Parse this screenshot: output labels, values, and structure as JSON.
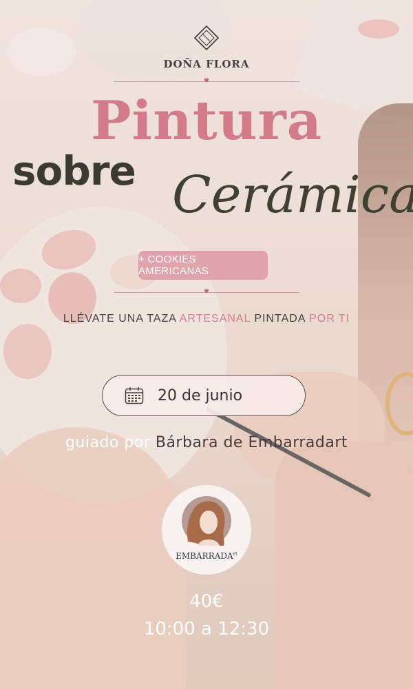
{
  "brand": {
    "name": "DOÑA FLORA",
    "icon": "diamond-logo-icon"
  },
  "title": {
    "line1": "Pintura",
    "line2": "sobre",
    "line3": "Cerámica"
  },
  "extra_pill": "+ COOKIES AMERICANAS",
  "tagline": {
    "part1": "LLÉVATE UNA TAZA ",
    "accent1": "ARTESANAL",
    "part2": " PINTADA ",
    "accent2": "POR TI"
  },
  "event": {
    "date": "20 de junio",
    "date_icon": "calendar-icon"
  },
  "guide": {
    "prefix": "guiado por ",
    "name": "Bárbara de Embarradart"
  },
  "host_logo": {
    "label": "EMBARRADA",
    "sup": "rt",
    "icon": "woman-portrait-icon"
  },
  "price": "40€",
  "time": "10:00 a 12:30",
  "colors": {
    "accent_pink": "#d27c8b",
    "dark_olive": "#3a3a30",
    "pill_pink": "#e0a3ab",
    "background": "#eddcd5"
  }
}
